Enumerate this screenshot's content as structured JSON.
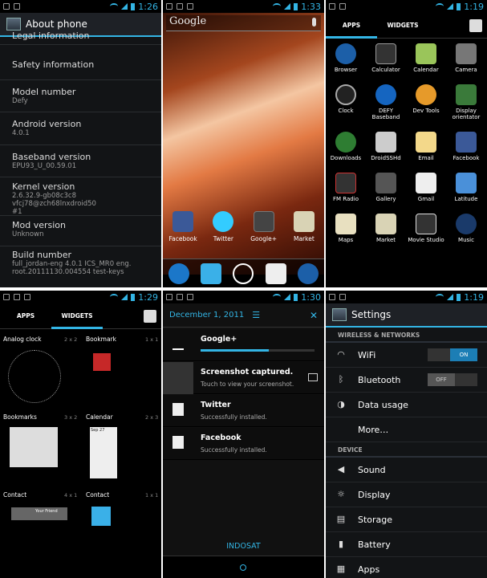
{
  "p1": {
    "time": "1:26",
    "title": "About phone",
    "items": [
      {
        "title": "Legal information",
        "summary": ""
      },
      {
        "title": "Safety information",
        "summary": ""
      },
      {
        "title": "Model number",
        "summary": "Defy"
      },
      {
        "title": "Android version",
        "summary": "4.0.1"
      },
      {
        "title": "Baseband version",
        "summary": "EPU93_U_00.59.01"
      },
      {
        "title": "Kernel version",
        "summary": "2.6.32.9-gb08c3c8 vfcj78@zch68lnxdroid50 #1"
      },
      {
        "title": "Mod version",
        "summary": "Unknown"
      },
      {
        "title": "Build number",
        "summary": "full_jordan-eng 4.0.1 ICS_MR0 eng. root.20111130.004554 test-keys"
      }
    ]
  },
  "p2": {
    "time": "1:33",
    "search": "Google",
    "apps": [
      "Facebook",
      "Twitter",
      "Google+",
      "Market"
    ]
  },
  "p3": {
    "time": "1:19",
    "tab_apps": "APPS",
    "tab_widgets": "WIDGETS",
    "apps": [
      "Browser",
      "Calculator",
      "Calendar",
      "Camera",
      "Clock",
      "DEFY Baseband",
      "Dev Tools",
      "Display orientator",
      "Downloads",
      "DroidSSHd",
      "Email",
      "Facebook",
      "FM Radio",
      "Gallery",
      "Gmail",
      "Latitude",
      "Maps",
      "Market",
      "Movie Studio",
      "Music"
    ]
  },
  "p4": {
    "time": "1:29",
    "tab_apps": "APPS",
    "tab_widgets": "WIDGETS",
    "widgets": [
      {
        "name": "Analog clock",
        "size": "2 x 2"
      },
      {
        "name": "Bookmark",
        "size": "1 x 1"
      },
      {
        "name": "Bookmarks",
        "size": "3 x 2"
      },
      {
        "name": "Calendar",
        "size": "2 x 3"
      },
      {
        "name": "Contact",
        "size": "4 x 1"
      },
      {
        "name": "Contact",
        "size": "1 x 1"
      }
    ],
    "your_friend": "Your Friend",
    "cal_date": "Sep 27"
  },
  "p5": {
    "time": "1:30",
    "date": "December 1, 2011",
    "notifications": [
      {
        "title": "Google+",
        "summary": ""
      },
      {
        "title": "Screenshot captured.",
        "summary": "Touch to view your screenshot."
      },
      {
        "title": "Twitter",
        "summary": "Successfully installed."
      },
      {
        "title": "Facebook",
        "summary": "Successfully installed."
      }
    ],
    "carrier": "INDOSAT"
  },
  "p6": {
    "time": "1:19",
    "title": "Settings",
    "section1": "WIRELESS & NETWORKS",
    "wifi": "WiFi",
    "wifi_state": "ON",
    "bluetooth": "Bluetooth",
    "bt_state": "OFF",
    "data_usage": "Data usage",
    "more": "More…",
    "section2": "DEVICE",
    "sound": "Sound",
    "display": "Display",
    "storage": "Storage",
    "battery": "Battery",
    "apps": "Apps"
  }
}
